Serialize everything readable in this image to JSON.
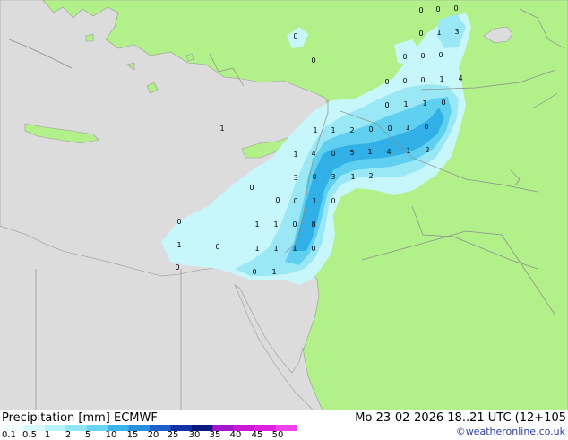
{
  "map": {
    "colors": {
      "sea": "#dcdcdc",
      "land": "#b2f08a",
      "precip_light": "#c8f7fb",
      "precip_mid": "#9ae8f6",
      "precip_strong": "#60d0f0",
      "precip_heavy": "#30b0e6",
      "border": "#8c8c8c"
    },
    "point_values": [
      {
        "v": "0"
      },
      {
        "v": "0"
      },
      {
        "v": "0"
      },
      {
        "v": "0"
      },
      {
        "v": "1"
      },
      {
        "v": "3"
      },
      {
        "v": "0"
      },
      {
        "v": "0"
      },
      {
        "v": "0"
      },
      {
        "v": "0"
      },
      {
        "v": "0"
      },
      {
        "v": "0"
      },
      {
        "v": "0"
      },
      {
        "v": "0"
      },
      {
        "v": "1"
      },
      {
        "v": "4"
      },
      {
        "v": "0"
      },
      {
        "v": "1"
      },
      {
        "v": "1"
      },
      {
        "v": "0"
      },
      {
        "v": "1"
      },
      {
        "v": "1"
      },
      {
        "v": "2"
      },
      {
        "v": "0"
      },
      {
        "v": "0"
      },
      {
        "v": "1"
      },
      {
        "v": "0"
      },
      {
        "v": "1"
      },
      {
        "v": "1"
      },
      {
        "v": "4"
      },
      {
        "v": "0"
      },
      {
        "v": "5"
      },
      {
        "v": "1"
      },
      {
        "v": "4"
      },
      {
        "v": "1"
      },
      {
        "v": "2"
      },
      {
        "v": "3"
      },
      {
        "v": "0"
      },
      {
        "v": "3"
      },
      {
        "v": "1"
      },
      {
        "v": "2"
      },
      {
        "v": "0"
      },
      {
        "v": "0"
      },
      {
        "v": "0"
      },
      {
        "v": "1"
      },
      {
        "v": "0"
      },
      {
        "v": "0"
      },
      {
        "v": "1"
      },
      {
        "v": "1"
      },
      {
        "v": "0"
      },
      {
        "v": "8"
      },
      {
        "v": "1"
      },
      {
        "v": "0"
      },
      {
        "v": "1"
      },
      {
        "v": "1"
      },
      {
        "v": "1"
      },
      {
        "v": "0"
      },
      {
        "v": "0"
      },
      {
        "v": "0"
      },
      {
        "v": "1"
      }
    ]
  },
  "footer": {
    "title": "Precipitation [mm]  ECMWF",
    "datetime": "Mo 23-02-2026 18..21 UTC (12+105",
    "credit": "©weatheronline.co.uk",
    "legend": {
      "ticks": [
        "0.1",
        "0.5",
        "1",
        "2",
        "5",
        "10",
        "15",
        "20",
        "25",
        "30",
        "35",
        "40",
        "45",
        "50"
      ],
      "colors": [
        "#f0fefe",
        "#d8fbfd",
        "#b8f3fb",
        "#90e6f7",
        "#68d4f2",
        "#3cb4ea",
        "#2a8ee0",
        "#1c60cc",
        "#1034a8",
        "#081a80",
        "#a018c8",
        "#c818d8",
        "#e020e0",
        "#f040e8"
      ]
    }
  }
}
